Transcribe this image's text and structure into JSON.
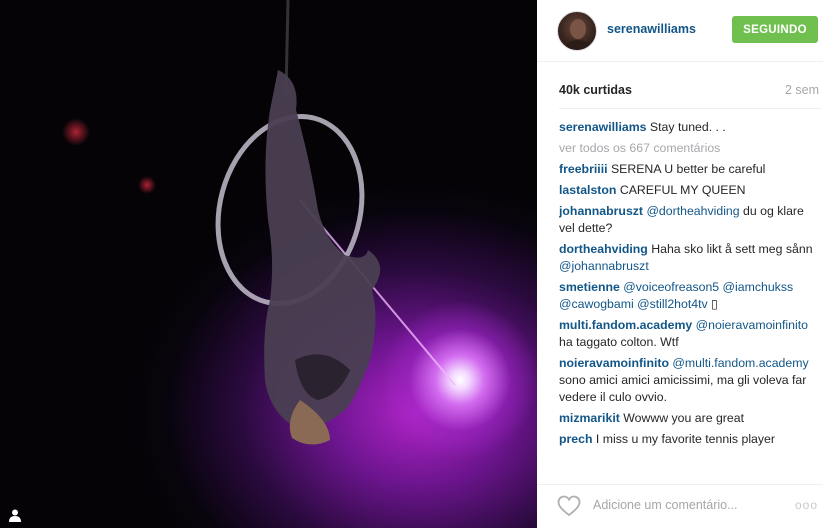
{
  "post": {
    "username": "serenawilliams",
    "follow_label": "SEGUINDO",
    "likes": "40k curtidas",
    "time": "2 sem",
    "caption": {
      "user": "serenawilliams",
      "text": " Stay tuned. . ."
    },
    "view_all": "ver todos os 667 comentários",
    "add_comment_placeholder": "Adicione um comentário...",
    "more_label": "ooo"
  },
  "comments": [
    {
      "user": "freebriiii",
      "text": " SERENA U better be careful"
    },
    {
      "user": "lastalston",
      "text": " CAREFUL MY QUEEN"
    },
    {
      "user": "johannabruszt",
      "mention": " @dortheahviding",
      "text": " du og klare vel dette?"
    },
    {
      "user": "dortheahviding",
      "text": " Haha sko likt å sett meg sånn ",
      "mention2": "@johannabruszt"
    },
    {
      "user": "smetienne",
      "mention": " @voiceofreason5 @iamchukss @cawogbami @still2hot4tv",
      "text": " ▯"
    },
    {
      "user": "multi.fandom.academy",
      "mention": " @noieravamoinfinito",
      "text": " ha taggato colton. Wtf"
    },
    {
      "user": "noieravamoinfinito",
      "mention": " @multi.fandom.academy",
      "text": " sono amici amici amicissimi, ma gli voleva far vedere il culo ovvio."
    },
    {
      "user": "mizmarikit",
      "text": " Wowww you are great"
    },
    {
      "user": "prech",
      "text": " I miss u my favorite tennis player"
    }
  ],
  "icons": {
    "heart": "heart-icon",
    "user_tag": "user-tag-icon",
    "avatar": "avatar"
  },
  "colors": {
    "username_blue": "#125688",
    "follow_green": "#70c050",
    "muted_gray": "#a5a7aa"
  }
}
